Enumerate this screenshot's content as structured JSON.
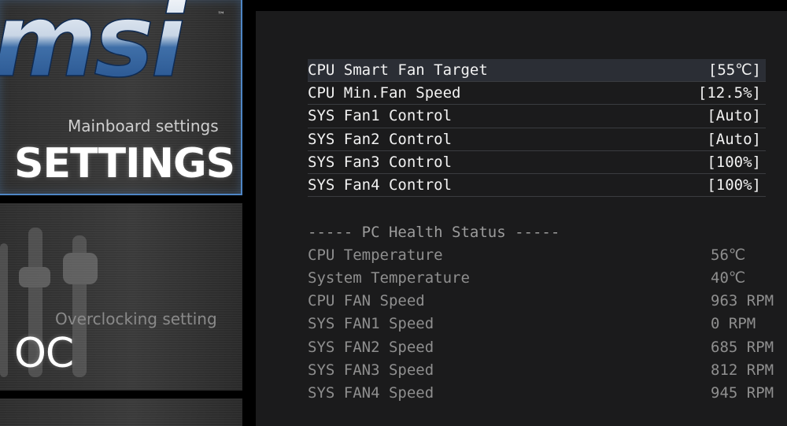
{
  "sidebar": {
    "settings_tile": {
      "subtitle": "Mainboard settings",
      "title": "SETTINGS"
    },
    "oc_tile": {
      "subtitle": "Overclocking setting",
      "title": "OC"
    }
  },
  "brand": {
    "logo_text": "msi",
    "trademark": "™",
    "accent_color": "#4f86c6"
  },
  "fan_settings": [
    {
      "label": "CPU Smart Fan Target",
      "value": "[55℃]"
    },
    {
      "label": "CPU Min.Fan Speed",
      "value": "[12.5%]"
    },
    {
      "label": "SYS Fan1 Control",
      "value": "[Auto]"
    },
    {
      "label": "SYS Fan2 Control",
      "value": "[Auto]"
    },
    {
      "label": "SYS Fan3 Control",
      "value": "[100%]"
    },
    {
      "label": "SYS Fan4 Control",
      "value": "[100%]"
    }
  ],
  "health": {
    "title": "----- PC Health Status -----",
    "items": [
      {
        "label": "CPU Temperature",
        "value": "56℃"
      },
      {
        "label": "System Temperature",
        "value": "40℃"
      },
      {
        "label": "CPU FAN Speed",
        "value": "963 RPM"
      },
      {
        "label": "SYS FAN1 Speed",
        "value": "0 RPM"
      },
      {
        "label": "SYS FAN2 Speed",
        "value": "685 RPM"
      },
      {
        "label": "SYS FAN3 Speed",
        "value": "812 RPM"
      },
      {
        "label": "SYS FAN4 Speed",
        "value": "945 RPM"
      }
    ]
  }
}
